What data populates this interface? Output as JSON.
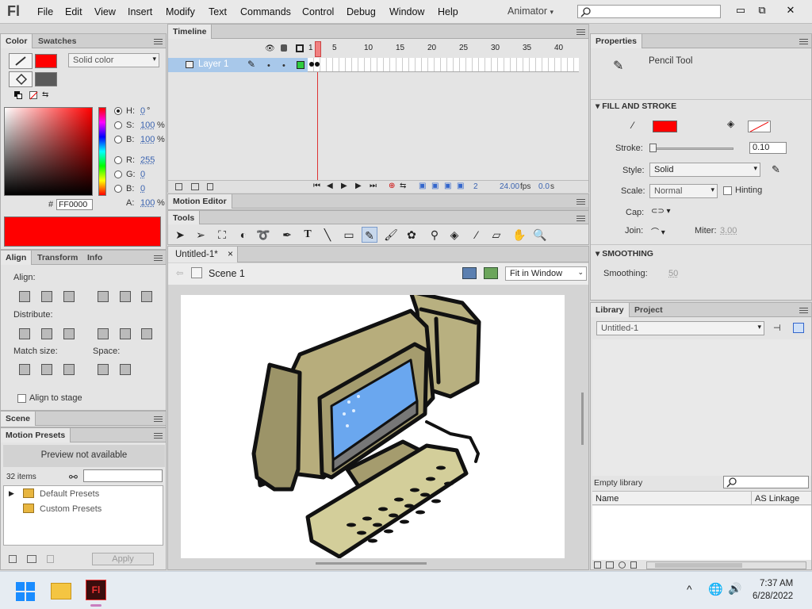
{
  "menubar": {
    "logo": "Fl",
    "items": [
      "File",
      "Edit",
      "View",
      "Insert",
      "Modify",
      "Text",
      "Commands",
      "Control",
      "Debug",
      "Window",
      "Help"
    ],
    "workspace": "Animator",
    "workspace_arrow": "▾",
    "window_buttons": [
      "▭",
      "⧉",
      "✕"
    ]
  },
  "color_panel": {
    "tabs": [
      "Color",
      "Swatches"
    ],
    "fill_type": "Solid color",
    "h_label": "H:",
    "h_val": "0",
    "h_unit": "°",
    "s_label": "S:",
    "s_val": "100",
    "s_unit": "%",
    "b_label": "B:",
    "b_val": "100",
    "b_unit": "%",
    "r_label": "R:",
    "r_val": "255",
    "g_label": "G:",
    "g_val": "0",
    "b2_label": "B:",
    "b2_val": "0",
    "hash": "#",
    "hex": "FF0000",
    "a_label": "A:",
    "a_val": "100",
    "a_unit": "%",
    "stroke_color": "#ff0000",
    "fill_color": "#5a5a5a"
  },
  "align_panel": {
    "tabs": [
      "Align",
      "Transform",
      "Info"
    ],
    "align_label": "Align:",
    "distribute_label": "Distribute:",
    "match_label": "Match size:",
    "space_label": "Space:",
    "stage_label": "Align to stage"
  },
  "scene_panel": {
    "tab": "Scene"
  },
  "presets_panel": {
    "tab": "Motion Presets",
    "preview": "Preview not available",
    "count": "32 items",
    "folders": [
      "Default Presets",
      "Custom Presets"
    ],
    "apply": "Apply"
  },
  "timeline": {
    "tab": "Timeline",
    "layer_name": "Layer 1",
    "frame_numbers": [
      "1",
      "5",
      "10",
      "15",
      "20",
      "25",
      "30",
      "35",
      "40"
    ],
    "current_frame": "2",
    "fps": "24.00",
    "fps_unit": "fps",
    "time": "0.0",
    "time_unit": "s"
  },
  "motion_editor": {
    "tab": "Motion Editor"
  },
  "tools_panel": {
    "tab": "Tools"
  },
  "document": {
    "tab": "Untitled-1*",
    "close": "×",
    "scene": "Scene 1",
    "zoom": "Fit in Window"
  },
  "properties": {
    "tab": "Properties",
    "tool_name": "Pencil Tool",
    "fill_stroke_header": "FILL AND STROKE",
    "stroke_label": "Stroke:",
    "stroke_val": "0.10",
    "style_label": "Style:",
    "style_val": "Solid",
    "scale_label": "Scale:",
    "scale_val": "Normal",
    "hinting_label": "Hinting",
    "cap_label": "Cap:",
    "join_label": "Join:",
    "miter_label": "Miter:",
    "miter_val": "3.00",
    "smoothing_header": "SMOOTHING",
    "smoothing_label": "Smoothing:",
    "smoothing_val": "50",
    "stroke_color": "#ff0000"
  },
  "library": {
    "tabs": [
      "Library",
      "Project"
    ],
    "doc": "Untitled-1",
    "empty": "Empty library",
    "col_name": "Name",
    "col_linkage": "AS Linkage"
  },
  "taskbar": {
    "time": "7:37 AM",
    "date": "6/28/2022",
    "app_label": "Fl"
  }
}
